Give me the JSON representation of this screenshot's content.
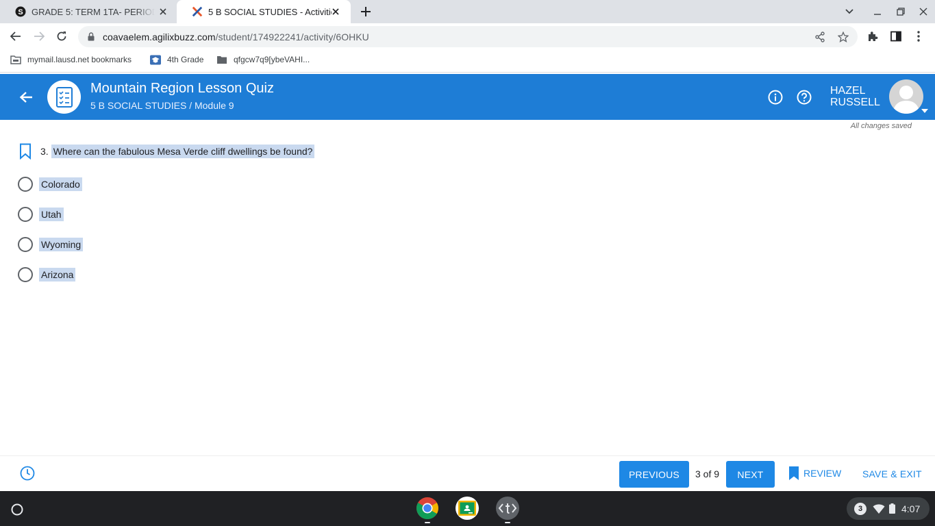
{
  "browser": {
    "tabs": [
      {
        "title": "GRADE 5: TERM 1TA- PERIOD 1 -",
        "active": false,
        "favicon": "schoology-s-icon"
      },
      {
        "title": "5 B SOCIAL STUDIES - Activities",
        "active": true,
        "favicon": "buzz-x-icon"
      }
    ],
    "url_host": "coavaelem.agilixbuzz.com",
    "url_path": "/student/174922241/activity/6OHKU",
    "bookmarks": [
      {
        "label": "mymail.lausd.net bookmarks",
        "icon": "folder-icon"
      },
      {
        "label": "4th Grade",
        "icon": "graduation-cap-icon"
      },
      {
        "label": "qfgcw7q9[ybeVAHI...",
        "icon": "folder-icon"
      }
    ]
  },
  "header": {
    "title": "Mountain Region Lesson Quiz",
    "subtitle": "5 B SOCIAL STUDIES / Module 9",
    "user_first": "HAZEL",
    "user_last": "RUSSELL",
    "brand_color": "#1e7dd6"
  },
  "status": {
    "saved": "All changes saved"
  },
  "question": {
    "number": "3.",
    "text": "Where can the fabulous Mesa Verde cliff dwellings be found?",
    "choices": [
      "Colorado",
      "Utah",
      "Wyoming",
      "Arizona"
    ]
  },
  "footer": {
    "previous": "PREVIOUS",
    "position": "3 of 9",
    "next": "NEXT",
    "review": "REVIEW",
    "save_exit": "SAVE & EXIT",
    "accent": "#1e88e5"
  },
  "shelf": {
    "apps": [
      "chrome-icon",
      "google-classroom-icon",
      "text-app-icon"
    ],
    "notifications": "3",
    "time": "4:07"
  }
}
